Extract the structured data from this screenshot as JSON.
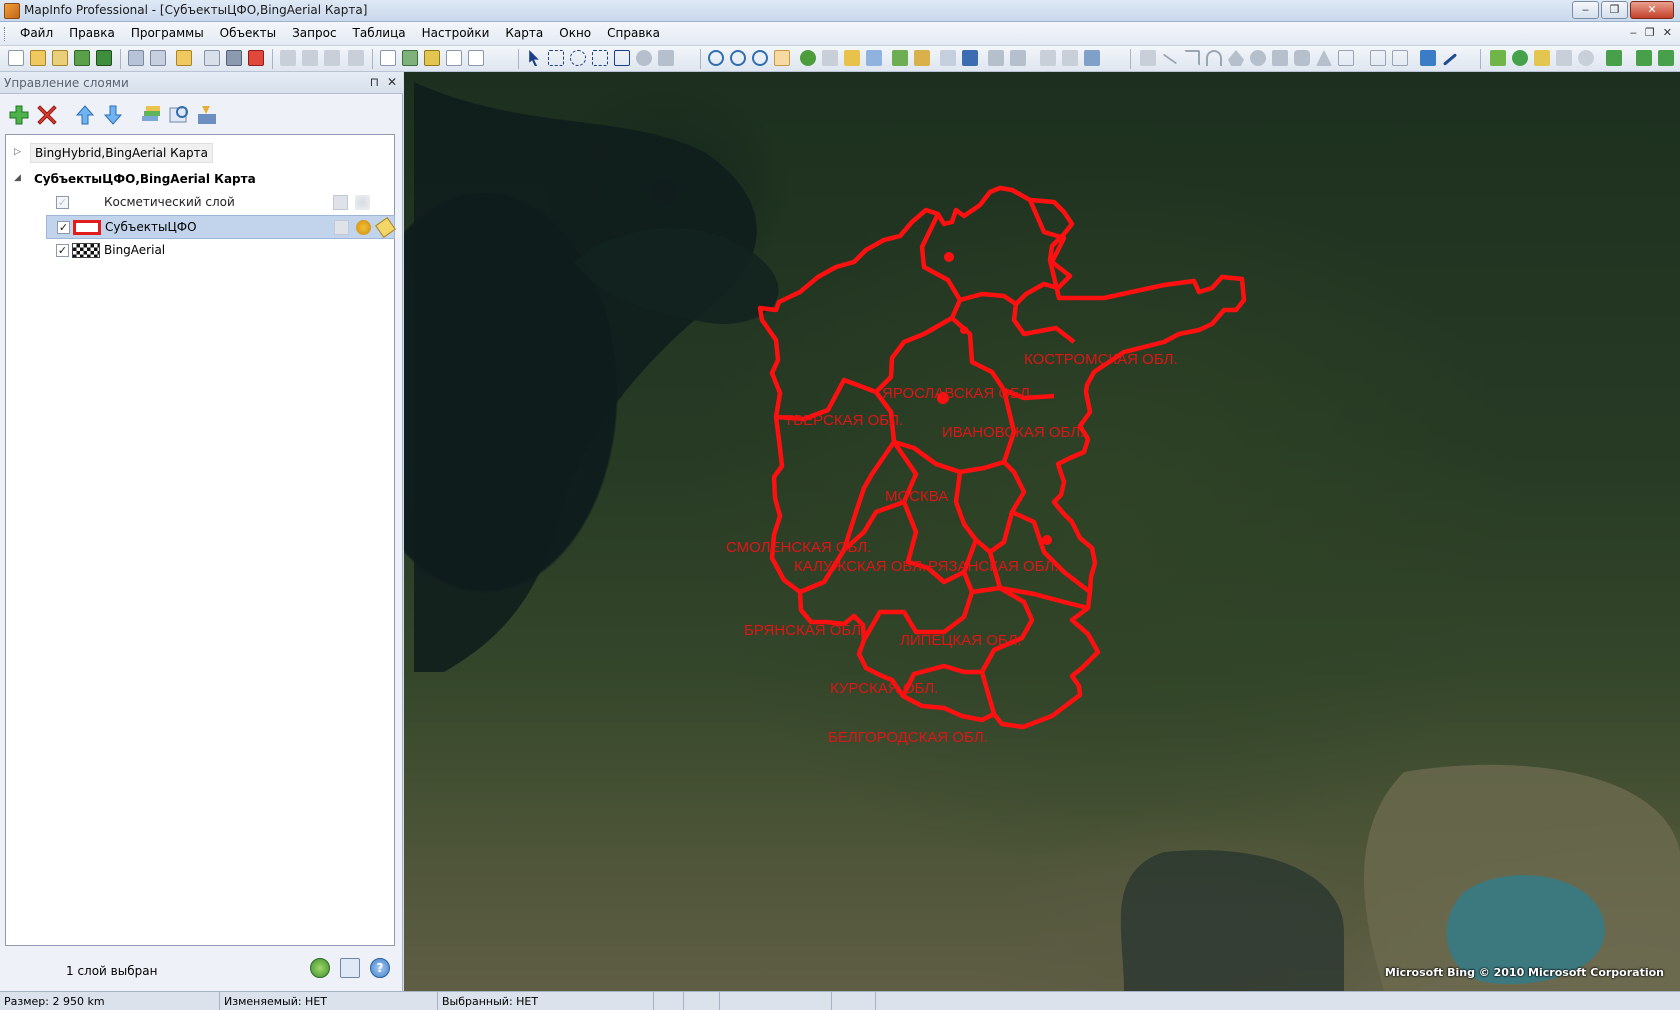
{
  "window": {
    "title": "MapInfo Professional - [СубъектыЦФО,BingAerial Карта]",
    "controls": [
      "‒",
      "❐",
      "✕"
    ]
  },
  "menu": {
    "items": [
      "Файл",
      "Правка",
      "Программы",
      "Объекты",
      "Запрос",
      "Таблица",
      "Настройки",
      "Карта",
      "Окно",
      "Справка"
    ],
    "mdi_controls": [
      "‒",
      "❐",
      "✕"
    ]
  },
  "layer_panel": {
    "title": "Управление слоями",
    "pin": "⊓",
    "close": "✕",
    "maps": [
      {
        "name": "BingHybrid,BingAerial Карта",
        "expanded": false
      },
      {
        "name": "СубъектыЦФО,BingAerial Карта",
        "expanded": true
      }
    ],
    "layers": [
      {
        "name": "Косметический слой",
        "checked": true,
        "enabled": false
      },
      {
        "name": "СубъектыЦФО",
        "checked": true,
        "enabled": true,
        "selected": true
      },
      {
        "name": "BingAerial",
        "checked": true,
        "enabled": true
      }
    ],
    "footer_status": "1 слой выбран"
  },
  "map": {
    "labels": [
      "КОСТРОМСКАЯ ОБЛ.",
      "ЯРОСЛАВСКАЯ ОБЛ.",
      "ТВЕРСКАЯ ОБЛ.",
      "ИВАНОВСКАЯ ОБЛ.",
      "МОСКВА",
      "СМОЛЕНСКАЯ ОБЛ.",
      "КАЛУЖСКАЯ ОБЛ.",
      "РЯЗАНСКАЯ ОБЛ.",
      "БРЯНСКАЯ ОБЛ.",
      "ЛИПЕЦКАЯ ОБЛ.",
      "КУРСКАЯ ОБЛ.",
      "БЕЛГОРОДСКАЯ ОБЛ."
    ],
    "copyright": "Microsoft Bing © 2010 Microsoft Corporation",
    "border_color": "#ff1010"
  },
  "status": {
    "size": "Размер: 2 950 km",
    "editable": "Изменяемый: НЕТ",
    "selected": "Выбранный: НЕТ"
  }
}
